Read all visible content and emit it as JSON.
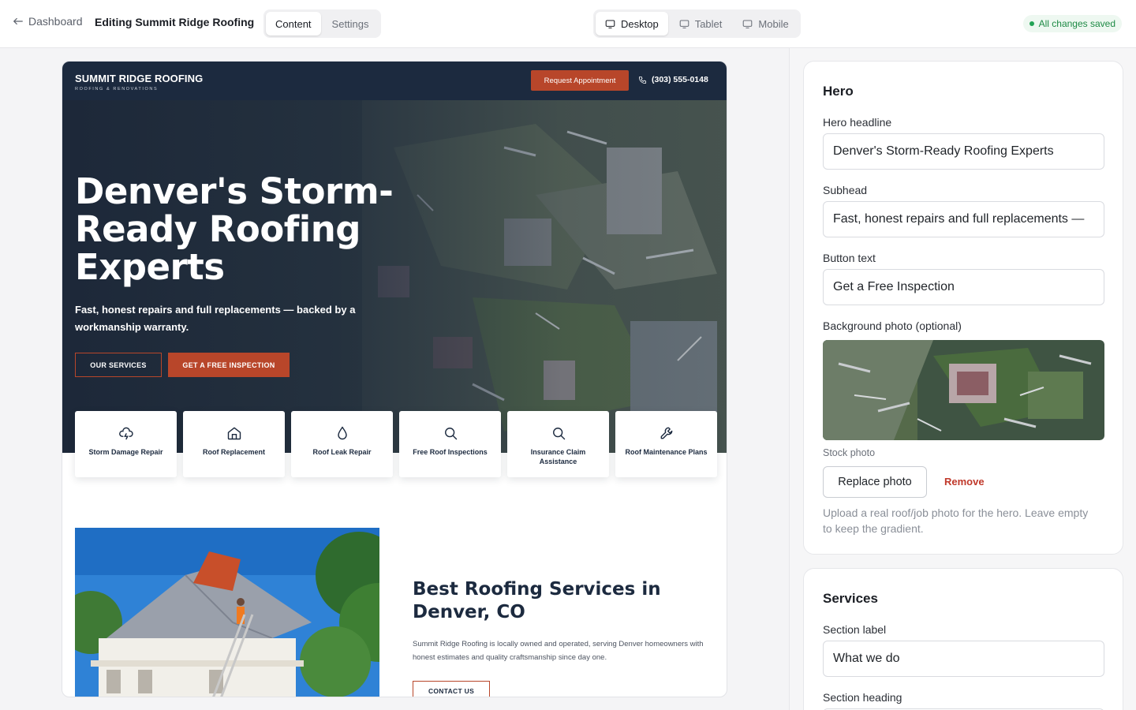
{
  "topbar": {
    "back_label": "Dashboard",
    "title": "Editing Summit Ridge Roofing",
    "content_tabs": [
      "Content",
      "Settings"
    ],
    "device_tabs": [
      "Desktop",
      "Tablet",
      "Mobile"
    ],
    "status": "All changes saved",
    "status_color": "#22a356"
  },
  "site": {
    "brand_name": "SUMMIT RIDGE ROOFING",
    "brand_tagline": "ROOFING & RENOVATIONS",
    "nav_cta": "Request Appointment",
    "phone": "(303) 555-0148",
    "accent_color": "#b8462a",
    "navy_color": "#1c2a3f",
    "hero": {
      "headline": "Denver's Storm-Ready Roofing Experts",
      "subhead": "Fast, honest repairs and full replacements — backed by a workmanship warranty.",
      "btn_secondary": "OUR SERVICES",
      "btn_primary": "GET A FREE INSPECTION"
    },
    "services": [
      {
        "label": "Storm Damage Repair",
        "icon": "cloud-lightning-icon"
      },
      {
        "label": "Roof Replacement",
        "icon": "home-icon"
      },
      {
        "label": "Roof Leak Repair",
        "icon": "droplet-icon"
      },
      {
        "label": "Free Roof Inspections",
        "icon": "search-icon"
      },
      {
        "label": "Insurance Claim Assistance",
        "icon": "search-icon"
      },
      {
        "label": "Roof Maintenance Plans",
        "icon": "wrench-icon"
      }
    ],
    "about": {
      "heading": "Best Roofing Services in Denver, CO",
      "body": "Summit Ridge Roofing is locally owned and operated, serving Denver homeowners with honest estimates and quality craftsmanship since day one.",
      "button": "CONTACT US"
    }
  },
  "panel": {
    "hero_card": {
      "title": "Hero",
      "headline_label": "Hero headline",
      "headline_value": "Denver's Storm-Ready Roofing Experts",
      "subhead_label": "Subhead",
      "subhead_value": "Fast, honest repairs and full replacements —",
      "button_label": "Button text",
      "button_value": "Get a Free Inspection",
      "bg_label": "Background photo (optional)",
      "photo_caption": "Stock photo",
      "replace_label": "Replace photo",
      "remove_label": "Remove",
      "help_text": "Upload a real roof/job photo for the hero. Leave empty to keep the gradient."
    },
    "services_card": {
      "title": "Services",
      "section_label_label": "Section label",
      "section_label_value": "What we do",
      "section_heading_label": "Section heading"
    }
  }
}
